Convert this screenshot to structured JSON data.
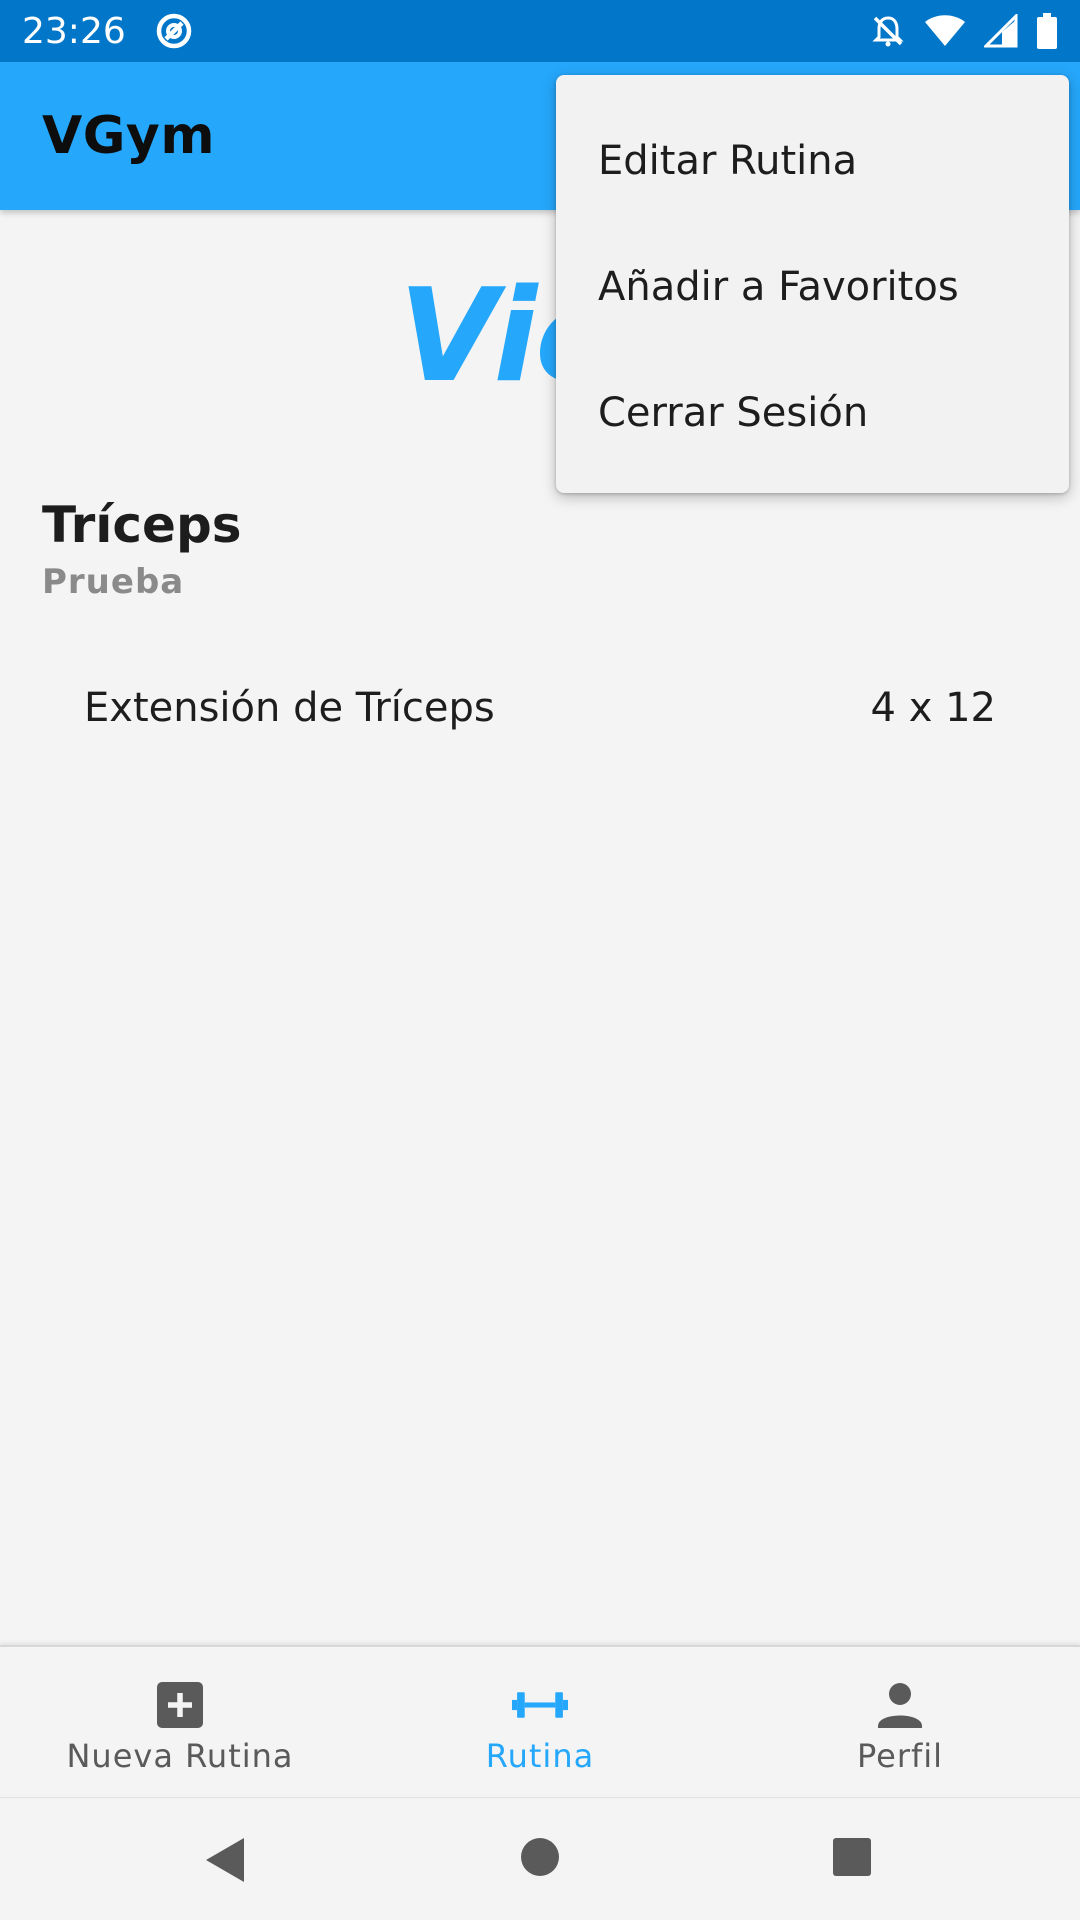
{
  "status_bar": {
    "time": "23:26",
    "background_color": "#0277c9",
    "icons": [
      "sync-icon",
      "notifications-off-icon",
      "wifi-icon",
      "cell-signal-icon",
      "battery-icon"
    ]
  },
  "app_bar": {
    "title": "VGym",
    "background_color": "#25a7fb"
  },
  "content": {
    "day_heading": "Vier",
    "routine": {
      "name": "Tríceps",
      "description": "Prueba"
    },
    "exercises": [
      {
        "name": "Extensión de Tríceps",
        "sets_reps": "4 x 12"
      }
    ]
  },
  "overflow_menu": {
    "items": [
      {
        "label": "Editar Rutina"
      },
      {
        "label": "Añadir a Favoritos"
      },
      {
        "label": "Cerrar Sesión"
      }
    ]
  },
  "bottom_nav": {
    "active_color": "#25a7fb",
    "items": [
      {
        "label": "Nueva Rutina",
        "icon": "add-box-icon",
        "active": false
      },
      {
        "label": "Rutina",
        "icon": "dumbbell-icon",
        "active": true
      },
      {
        "label": "Perfil",
        "icon": "person-icon",
        "active": false
      }
    ]
  },
  "system_nav": {
    "icons": [
      "back-icon",
      "home-icon",
      "recents-icon"
    ]
  }
}
